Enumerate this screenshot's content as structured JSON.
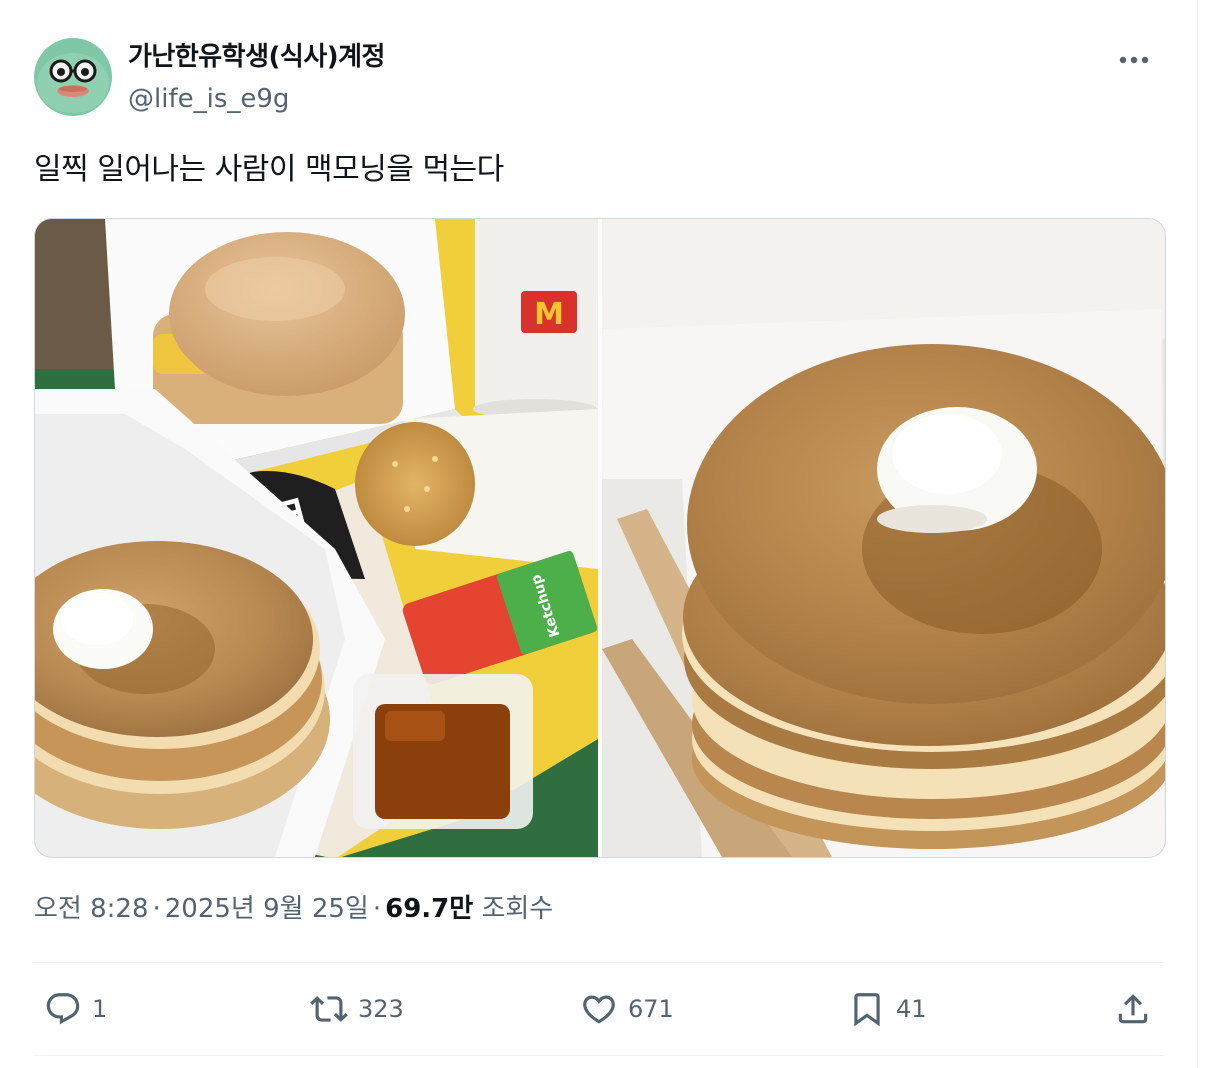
{
  "user": {
    "display_name": "가난한유학생(식사)계정",
    "handle": "@life_is_e9g"
  },
  "tweet": {
    "text": "일찍 일어나는 사람이 맥모닝을 먹는다"
  },
  "media": {
    "left_photo": {
      "logo_letter": "M",
      "sauce_label": "Ketchup"
    }
  },
  "meta": {
    "time": "오전 8:28",
    "separator": "·",
    "date": "2025년 9월 25일",
    "views_count": "69.7만",
    "views_label": "조회수"
  },
  "actions": {
    "replies": "1",
    "reposts": "323",
    "likes": "671",
    "bookmarks": "41"
  },
  "icons": [
    "more-icon",
    "reply-icon",
    "repost-icon",
    "like-icon",
    "bookmark-icon",
    "share-icon"
  ],
  "colors": {
    "text_primary": "#0f1419",
    "text_secondary": "#536471",
    "border": "#cfd9de",
    "divider": "#eff3f4"
  }
}
